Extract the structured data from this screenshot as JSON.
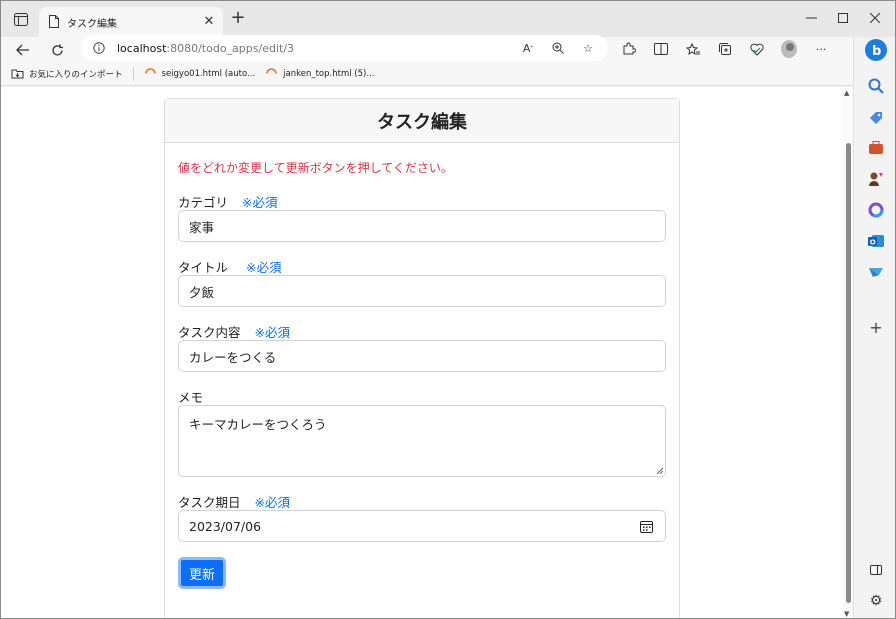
{
  "browser": {
    "tab_title": "タスク編集",
    "url_host": "localhost",
    "url_rest": ":8080/todo_apps/edit/3",
    "bookmarks": [
      {
        "label": "お気に入りのインポート"
      },
      {
        "label": "seigyo01.html (auto..."
      },
      {
        "label": "janken_top.html (5)..."
      }
    ]
  },
  "page": {
    "title": "タスク編集",
    "notice": "値をどれか変更して更新ボタンを押してください。",
    "required_mark": "※必須",
    "fields": [
      {
        "label": "カテゴリ",
        "value": "家事",
        "required": true
      },
      {
        "label": "タイトル",
        "value": "夕飯",
        "required": true
      },
      {
        "label": "タスク内容",
        "value": "カレーをつくる",
        "required": true
      },
      {
        "label": "メモ",
        "value": "キーマカレーをつくろう",
        "required": false
      },
      {
        "label": "タスク期日",
        "value": "2023/07/06",
        "required": true
      }
    ],
    "submit_label": "更新"
  },
  "colors": {
    "notice": "#dc3545",
    "required": "#0d6efd",
    "button": "#0d6efd"
  }
}
